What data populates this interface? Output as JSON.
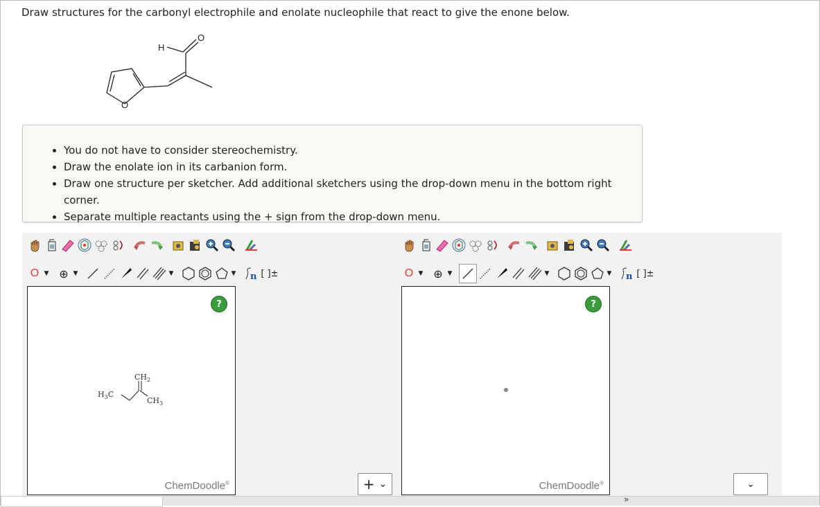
{
  "question": "Draw structures for the carbonyl electrophile and enolate nucleophile that react to give the enone below.",
  "structure": {
    "h_label": "H",
    "o_carbonyl": "O",
    "o_ring": "O"
  },
  "hints": [
    "You do not have to consider stereochemistry.",
    "Draw the enolate ion in its carbanion form.",
    "Draw one structure per sketcher. Add additional sketchers using the drop-down menu in the bottom right corner.",
    "Separate multiple reactants using the + sign from the drop-down menu."
  ],
  "toolbar": {
    "atom_label": "O",
    "charge_label": "⊕",
    "bracket_label": "[ ]±",
    "sn_label": "n"
  },
  "sketcher1": {
    "help": "?",
    "brand": "ChemDoodle",
    "mol": {
      "ch2": "CH",
      "ch2_sub": "2",
      "h3c_h": "H",
      "h3c_sub": "3",
      "h3c_c": "C",
      "ch3": "CH",
      "ch3_sub": "3"
    }
  },
  "sketcher2": {
    "help": "?",
    "brand": "ChemDoodle"
  },
  "add_menu": {
    "plus": "+",
    "caret": "⌄"
  },
  "right_menu": {
    "caret": "⌄"
  },
  "footer_chevron": "»"
}
